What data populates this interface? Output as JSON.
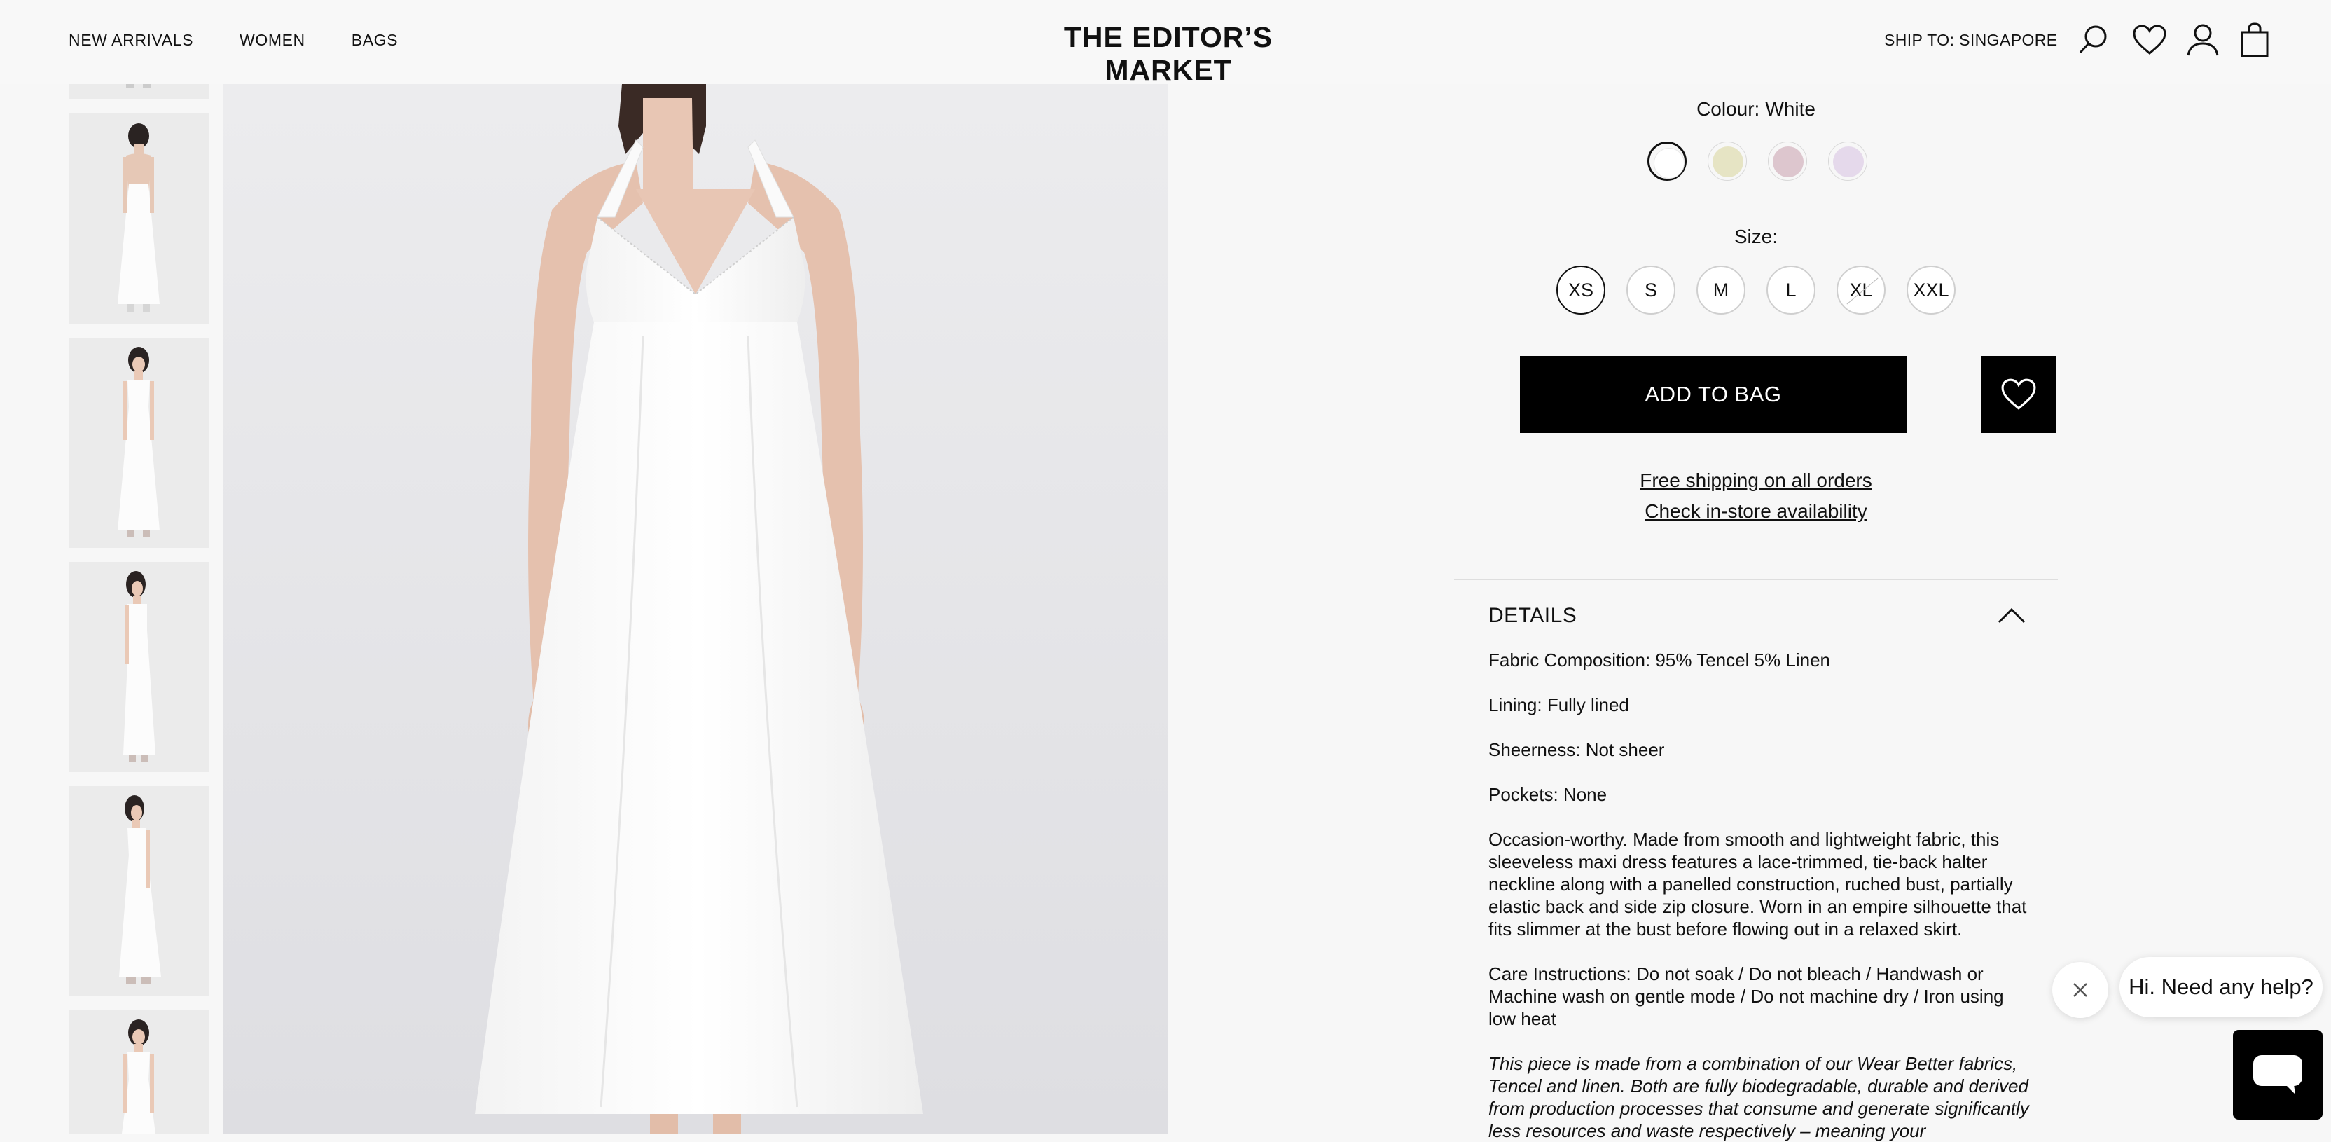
{
  "header": {
    "nav": [
      "NEW ARRIVALS",
      "WOMEN",
      "BAGS"
    ],
    "brand": "THE EDITOR’S MARKET",
    "ship_to": "SHIP TO: SINGAPORE",
    "icons": [
      "search-icon",
      "heart-icon",
      "account-icon",
      "bag-icon"
    ]
  },
  "product": {
    "colour_label": "Colour:",
    "colour_value": "White",
    "swatches": [
      {
        "name": "White",
        "color": "#ffffff",
        "selected": true
      },
      {
        "name": "Butter",
        "color": "#e6e4c4",
        "selected": false
      },
      {
        "name": "Rose",
        "color": "#ddc6ce",
        "selected": false
      },
      {
        "name": "Lilac",
        "color": "#e5d9eb",
        "selected": false
      }
    ],
    "size_label": "Size:",
    "sizes": [
      {
        "label": "XS",
        "selected": true,
        "available": true
      },
      {
        "label": "S",
        "selected": false,
        "available": true
      },
      {
        "label": "M",
        "selected": false,
        "available": true
      },
      {
        "label": "L",
        "selected": false,
        "available": true
      },
      {
        "label": "XL",
        "selected": false,
        "available": false
      },
      {
        "label": "XXL",
        "selected": false,
        "available": true
      }
    ],
    "add_to_bag": "ADD TO BAG",
    "free_shipping": "Free shipping on all orders",
    "instore": "Check in-store availability"
  },
  "details": {
    "title": "DETAILS",
    "fabric": "Fabric Composition: 95% Tencel 5% Linen",
    "lining": "Lining: Fully lined",
    "sheerness": "Sheerness: Not sheer",
    "pockets": "Pockets: None",
    "description": "Occasion-worthy. Made from smooth and lightweight fabric, this sleeveless maxi dress features a lace-trimmed, tie-back halter neckline along with a panelled construction, ruched bust, partially elastic back and side zip closure. Worn in an empire silhouette that fits slimmer at the bust before flowing out in a relaxed skirt.",
    "care": "Care Instructions: Do not soak / Do not bleach / Handwash or Machine wash on gentle mode / Do not machine dry / Iron using low heat",
    "sustain": "This piece is made from a combination of our Wear Better fabrics, Tencel and linen. Both are fully biodegradable, durable and derived from production processes that consume and generate significantly less resources and waste respectively – meaning your"
  },
  "chat": {
    "prompt": "Hi. Need any help?"
  }
}
